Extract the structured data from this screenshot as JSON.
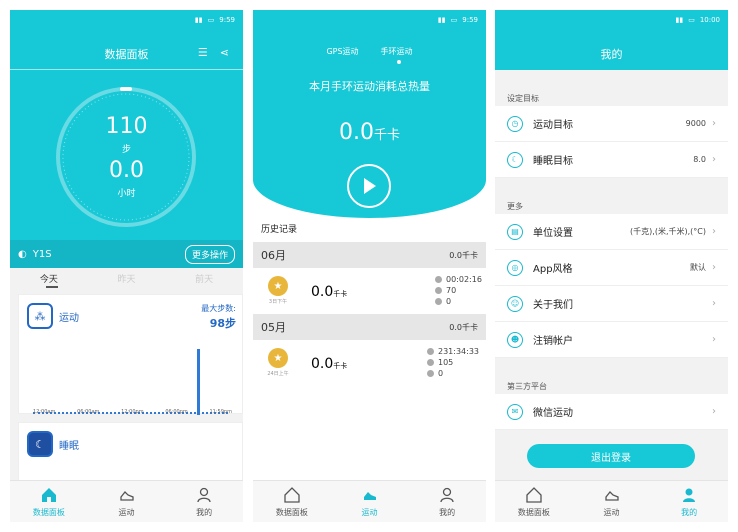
{
  "status_bar": {
    "time_1": "9:59",
    "time_2": "9:59",
    "time_3": "10:00"
  },
  "dashboard": {
    "title": "数据面板",
    "steps": "110",
    "steps_unit": "步",
    "hours": "0.0",
    "hours_unit": "小时",
    "device": "Y1S",
    "more_button": "更多操作",
    "days": [
      "今天",
      "昨天",
      "前天"
    ],
    "sport_card": {
      "title": "运动",
      "max_label": "最大步数:",
      "max_value": "98步",
      "time_labels": [
        "12:00am",
        "06:00am",
        "12:00pm",
        "06:00pm",
        "11:59pm"
      ]
    },
    "sleep_card": {
      "title": "睡眠"
    }
  },
  "sport": {
    "tabs": [
      "GPS运动",
      "手环运动"
    ],
    "headline": "本月手环运动消耗总热量",
    "total": "0.0",
    "total_unit": "千卡",
    "history_title": "历史记录",
    "months": [
      {
        "month": "06月",
        "month_total": "0.0千卡",
        "date": "3日下午",
        "kcal": "0.0",
        "unit": "千卡",
        "duration": "00:02:16",
        "steps": "70",
        "distance": "0"
      },
      {
        "month": "05月",
        "month_total": "0.0千卡",
        "date": "24日上午",
        "kcal": "0.0",
        "unit": "千卡",
        "duration": "231:34:33",
        "steps": "105",
        "distance": "0"
      }
    ]
  },
  "profile": {
    "title": "我的",
    "section_goals": "设定目标",
    "goals": [
      {
        "label": "运动目标",
        "value": "9000"
      },
      {
        "label": "睡眠目标",
        "value": "8.0"
      }
    ],
    "section_more": "更多",
    "more": [
      {
        "label": "单位设置",
        "value": "(千克),(米,千米),(°C)"
      },
      {
        "label": "App风格",
        "value": "默认"
      },
      {
        "label": "关于我们",
        "value": ""
      },
      {
        "label": "注销帐户",
        "value": ""
      }
    ],
    "section_third": "第三方平台",
    "third": [
      {
        "label": "微信运动",
        "value": ""
      }
    ],
    "logout": "退出登录"
  },
  "tabbar": {
    "labels": [
      "数据面板",
      "运动",
      "我的"
    ]
  },
  "colors": {
    "teal": "#17c8d6",
    "blue": "#2468c5",
    "gold": "#e8b63a"
  }
}
